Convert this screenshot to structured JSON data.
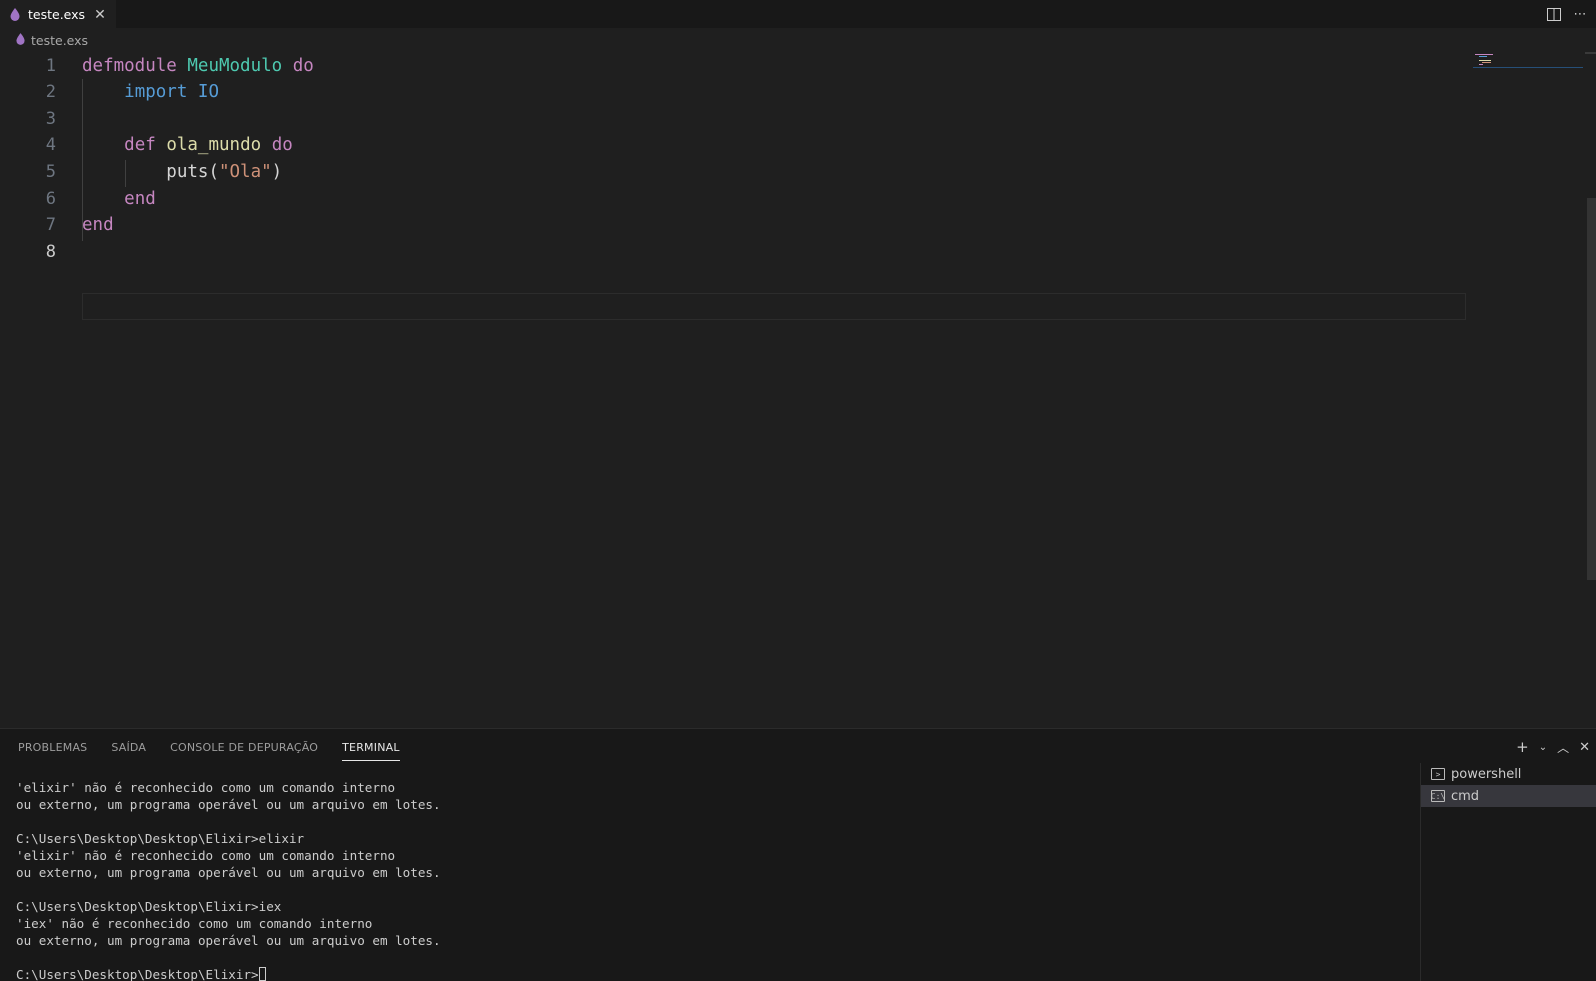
{
  "tabs": [
    {
      "label": "teste.exs",
      "close": "✕"
    }
  ],
  "breadcrumb": {
    "file": "teste.exs"
  },
  "editor": {
    "line_numbers": [
      "1",
      "2",
      "3",
      "4",
      "5",
      "6",
      "7",
      "8"
    ],
    "lines": [
      [
        {
          "t": "defmodule",
          "c": "kw"
        },
        {
          "t": " ",
          "c": "plain"
        },
        {
          "t": "MeuModulo",
          "c": "mod"
        },
        {
          "t": " ",
          "c": "plain"
        },
        {
          "t": "do",
          "c": "kw"
        }
      ],
      [
        {
          "t": "    ",
          "c": "plain"
        },
        {
          "t": "import",
          "c": "imp"
        },
        {
          "t": " ",
          "c": "plain"
        },
        {
          "t": "IO",
          "c": "imp"
        }
      ],
      [],
      [
        {
          "t": "    ",
          "c": "plain"
        },
        {
          "t": "def",
          "c": "kw"
        },
        {
          "t": " ",
          "c": "plain"
        },
        {
          "t": "ola_mundo",
          "c": "fn"
        },
        {
          "t": " ",
          "c": "plain"
        },
        {
          "t": "do",
          "c": "kw"
        }
      ],
      [
        {
          "t": "        ",
          "c": "plain"
        },
        {
          "t": "puts(",
          "c": "plain"
        },
        {
          "t": "\"Ola\"",
          "c": "str"
        },
        {
          "t": ")",
          "c": "plain"
        }
      ],
      [
        {
          "t": "    ",
          "c": "plain"
        },
        {
          "t": "end",
          "c": "kw"
        }
      ],
      [
        {
          "t": "end",
          "c": "kw"
        }
      ],
      []
    ]
  },
  "panel": {
    "tabs": [
      "PROBLEMAS",
      "SAÍDA",
      "CONSOLE DE DEPURAÇÃO",
      "TERMINAL"
    ],
    "active_tab": "TERMINAL",
    "terminal_lines": [
      "'elixir' não é reconhecido como um comando interno",
      "ou externo, um programa operável ou um arquivo em lotes.",
      "",
      "C:\\Users\\Desktop\\Desktop\\Elixir>elixir",
      "'elixir' não é reconhecido como um comando interno",
      "ou externo, um programa operável ou um arquivo em lotes.",
      "",
      "C:\\Users\\Desktop\\Desktop\\Elixir>iex",
      "'iex' não é reconhecido como um comando interno",
      "ou externo, um programa operável ou um arquivo em lotes.",
      ""
    ],
    "prompt": "C:\\Users\\Desktop\\Desktop\\Elixir>",
    "terminals": [
      {
        "label": "powershell",
        "icon": "terminal-icon",
        "active": false
      },
      {
        "label": "cmd",
        "icon": "cmd-icon",
        "active": true
      }
    ]
  }
}
